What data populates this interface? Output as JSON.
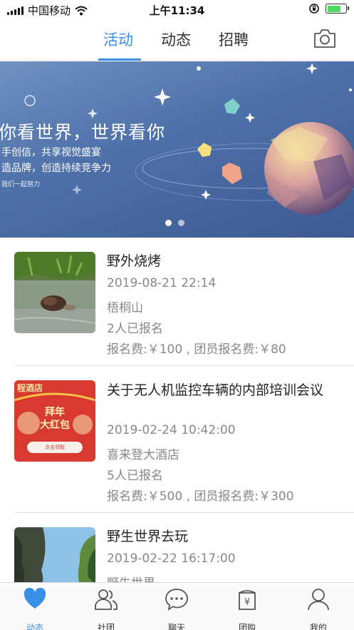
{
  "status_bar": {
    "carrier": "中国移动",
    "time": "上午11:34"
  },
  "top_nav": {
    "tabs": [
      {
        "label": "活动"
      },
      {
        "label": "动态"
      },
      {
        "label": "招聘"
      }
    ],
    "active_tab": "活动"
  },
  "banner": {
    "title": "你看世界，世界看你",
    "line1": "手创信，共享视觉盛宴",
    "line2": "造品牌，创造持续竞争力",
    "line3": "我们一起努力",
    "page_count": 2,
    "active_page": 1
  },
  "events": [
    {
      "title": "野外烧烤",
      "datetime": "2019-08-21 22:14",
      "location": "梧桐山",
      "signups": "2人已报名",
      "fee": "报名费:￥100 , 团员报名费:￥80"
    },
    {
      "title": "关于无人机监控车辆的内部培训会议",
      "datetime": "2019-02-24 10:42:00",
      "location": "喜来登大酒店",
      "signups": "5人已报名",
      "fee": "报名费:￥500 , 团员报名费:￥300",
      "thumb_text": {
        "hotel": "程酒店",
        "line1": "拜年",
        "line2": "大红包",
        "button": "点击领取"
      }
    },
    {
      "title": "野生世界去玩",
      "datetime": "2019-02-22 16:17:00",
      "location": "野生世界"
    }
  ],
  "bottom_tabs": [
    {
      "label": "动态",
      "icon": "heart-icon"
    },
    {
      "label": "社团",
      "icon": "group-icon"
    },
    {
      "label": "聊天",
      "icon": "chat-icon"
    },
    {
      "label": "团购",
      "icon": "yen-bag-icon"
    },
    {
      "label": "我的",
      "icon": "person-icon"
    }
  ],
  "colors": {
    "accent": "#3a8ee6",
    "text": "#222222",
    "meta": "#888888"
  }
}
